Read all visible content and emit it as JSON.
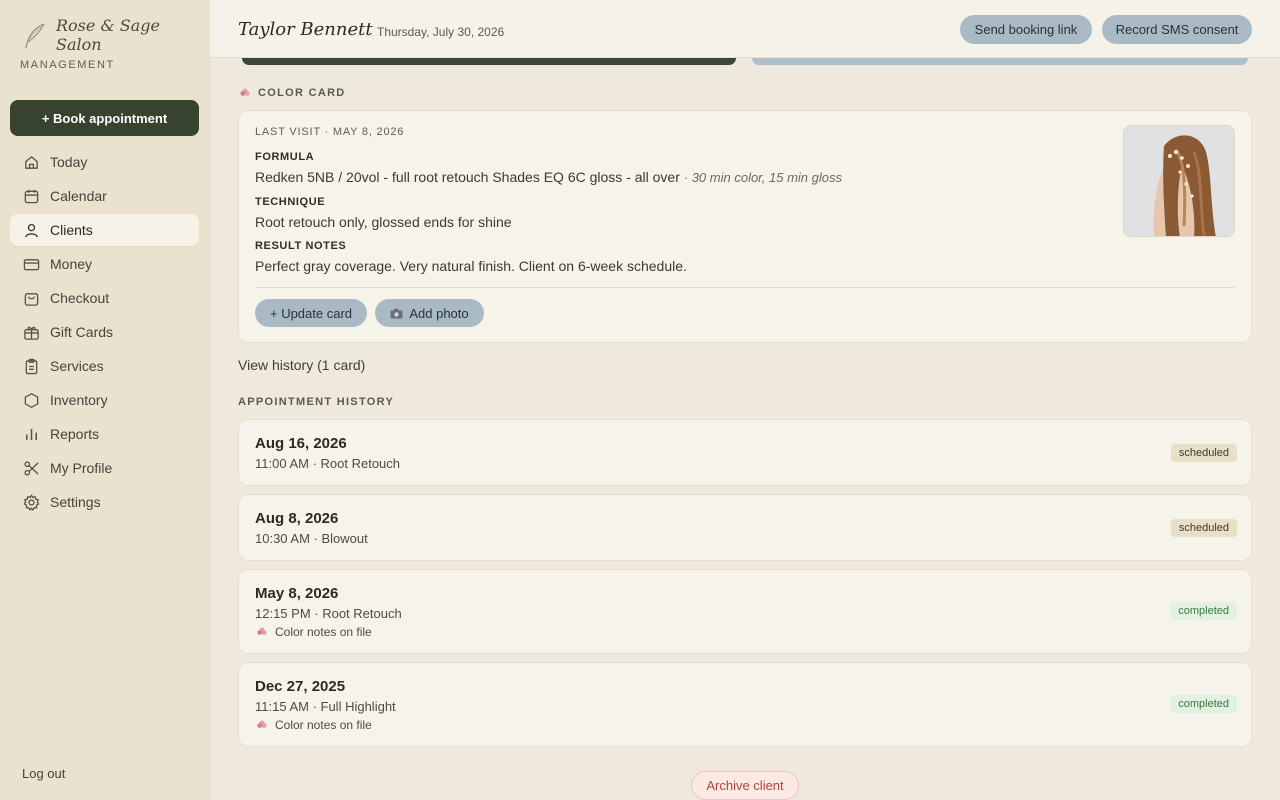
{
  "brand": {
    "name": "Rose & Sage Salon",
    "sub": "MANAGEMENT"
  },
  "sidebar": {
    "book_label": "+ Book appointment",
    "items": [
      {
        "label": "Today",
        "icon": "home-icon"
      },
      {
        "label": "Calendar",
        "icon": "calendar-icon"
      },
      {
        "label": "Clients",
        "icon": "user-icon",
        "active": true
      },
      {
        "label": "Money",
        "icon": "card-icon"
      },
      {
        "label": "Checkout",
        "icon": "bag-icon"
      },
      {
        "label": "Gift Cards",
        "icon": "gift-icon"
      },
      {
        "label": "Services",
        "icon": "clipboard-icon"
      },
      {
        "label": "Inventory",
        "icon": "box-icon"
      },
      {
        "label": "Reports",
        "icon": "bar-chart-icon"
      },
      {
        "label": "My Profile",
        "icon": "scissors-icon"
      },
      {
        "label": "Settings",
        "icon": "gear-icon"
      }
    ],
    "logout_label": "Log out"
  },
  "header": {
    "client_name": "Taylor Bennett",
    "date": "Thursday, July 30, 2026",
    "send_booking_label": "Send booking link",
    "sms_consent_label": "Record SMS consent"
  },
  "color_card": {
    "section_title": "COLOR CARD",
    "last_visit": "LAST VISIT · MAY 8, 2026",
    "formula_heading": "FORMULA",
    "formula_text": "Redken 5NB / 20vol - full root retouch Shades EQ 6C gloss - all over",
    "formula_timing": "· 30 min color, 15 min gloss",
    "technique_heading": "TECHNIQUE",
    "technique_text": "Root retouch only, glossed ends for shine",
    "result_heading": "RESULT NOTES",
    "result_text": "Perfect gray coverage. Very natural finish. Client on 6-week schedule.",
    "update_label": "+ Update card",
    "add_photo_label": "Add photo",
    "view_history_label": "View history (1 card)"
  },
  "appointments": {
    "section_title": "APPOINTMENT HISTORY",
    "items": [
      {
        "date": "Aug 16, 2026",
        "detail": "11:00 AM · Root Retouch",
        "status": "scheduled",
        "note": ""
      },
      {
        "date": "Aug 8, 2026",
        "detail": "10:30 AM · Blowout",
        "status": "scheduled",
        "note": ""
      },
      {
        "date": "May 8, 2026",
        "detail": "12:15 PM · Root Retouch",
        "status": "completed",
        "note": "Color notes on file"
      },
      {
        "date": "Dec 27, 2025",
        "detail": "11:15 AM · Full Highlight",
        "status": "completed",
        "note": "Color notes on file"
      }
    ]
  },
  "archive_label": "Archive client",
  "colors": {
    "primary_dark": "#37432f",
    "pill_blue": "#a9bac4",
    "badge_scheduled": "#e8dfc9",
    "badge_completed": "#e3f1e2",
    "danger": "#b4433a"
  }
}
